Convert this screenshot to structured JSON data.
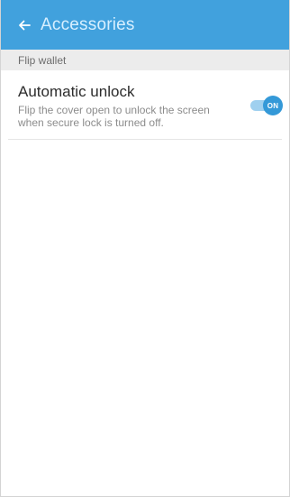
{
  "app_bar": {
    "title": "Accessories",
    "back_icon": "arrow-left-icon"
  },
  "section": {
    "header": "Flip wallet"
  },
  "setting": {
    "title": "Automatic unlock",
    "description": "Flip the cover open to unlock the screen when secure lock is turned off.",
    "toggle_label": "ON",
    "toggle_state": "on"
  },
  "colors": {
    "app_bar": "#41a1dd",
    "title_text": "#d7efff",
    "section_bg": "#ececec",
    "toggle_track": "#9fd0ef",
    "toggle_knob": "#3499d8"
  }
}
